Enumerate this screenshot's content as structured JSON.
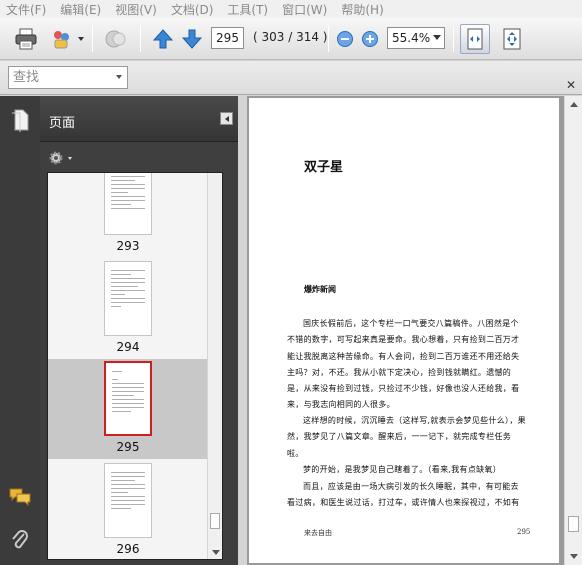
{
  "menu": [
    "文件(F)",
    "编辑(E)",
    "视图(V)",
    "文档(D)",
    "工具(T)",
    "窗口(W)",
    "帮助(H)"
  ],
  "toolbar": {
    "current_page": "295",
    "page_count": "( 303 / 314 )",
    "zoom": "55.4%",
    "icons": [
      "printer-icon",
      "collaborate-icon",
      "send-icon",
      "previous-page-icon",
      "next-page-icon",
      "zoom-out-icon",
      "zoom-in-icon",
      "fit-width-icon",
      "full-screen-icon"
    ]
  },
  "find": {
    "placeholder": "查找"
  },
  "panel": {
    "title": "页面",
    "thumbnails": [
      {
        "label": "293",
        "selected": false
      },
      {
        "label": "294",
        "selected": false
      },
      {
        "label": "295",
        "selected": true
      },
      {
        "label": "296",
        "selected": false
      }
    ]
  },
  "document": {
    "title": "双子星",
    "subtitle": "爆炸新闻",
    "paragraphs": [
      "国庆长假前后，这个专栏一口气要交八篇稿件。八困然是个不错的数字，可写起来真是要命。我心想着，只有捡到二百万才能让我脱离这种苦缘命。有人会问，捡到二百万谁还不用还给失主吗？对，不还。我从小就下定决心，捡到钱就瞒红。遗憾的是，从来没有捡到过钱，只捡过不少钱，好像也没人还给我，看来，与我志向相同的人很多。",
      "这样想的时候，沉沉睡去（这样写,就表示会梦见些什么），果然，我梦见了八篇文章。醒来后，一一记下，就完成专栏任务啦。",
      "梦的开始，是我梦见自己瞎着了。（看来,我有点缺氧）",
      "而且，应该是由一场大病引发的长久睡眠，其中，有可能去看过病，和医生说过话，打过车，或许情人也来探视过，不如有没有"
    ],
    "footer_left": "来去自由",
    "footer_right": "295"
  }
}
